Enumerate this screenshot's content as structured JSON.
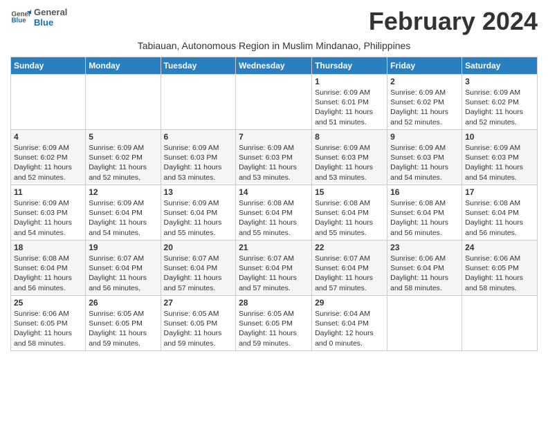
{
  "header": {
    "logo_line1": "General",
    "logo_line2": "Blue",
    "title": "February 2024",
    "subtitle": "Tabiauan, Autonomous Region in Muslim Mindanao, Philippines"
  },
  "days_of_week": [
    "Sunday",
    "Monday",
    "Tuesday",
    "Wednesday",
    "Thursday",
    "Friday",
    "Saturday"
  ],
  "weeks": [
    [
      {
        "day": "",
        "info": ""
      },
      {
        "day": "",
        "info": ""
      },
      {
        "day": "",
        "info": ""
      },
      {
        "day": "",
        "info": ""
      },
      {
        "day": "1",
        "info": "Sunrise: 6:09 AM\nSunset: 6:01 PM\nDaylight: 11 hours\nand 51 minutes."
      },
      {
        "day": "2",
        "info": "Sunrise: 6:09 AM\nSunset: 6:02 PM\nDaylight: 11 hours\nand 52 minutes."
      },
      {
        "day": "3",
        "info": "Sunrise: 6:09 AM\nSunset: 6:02 PM\nDaylight: 11 hours\nand 52 minutes."
      }
    ],
    [
      {
        "day": "4",
        "info": "Sunrise: 6:09 AM\nSunset: 6:02 PM\nDaylight: 11 hours\nand 52 minutes."
      },
      {
        "day": "5",
        "info": "Sunrise: 6:09 AM\nSunset: 6:02 PM\nDaylight: 11 hours\nand 52 minutes."
      },
      {
        "day": "6",
        "info": "Sunrise: 6:09 AM\nSunset: 6:03 PM\nDaylight: 11 hours\nand 53 minutes."
      },
      {
        "day": "7",
        "info": "Sunrise: 6:09 AM\nSunset: 6:03 PM\nDaylight: 11 hours\nand 53 minutes."
      },
      {
        "day": "8",
        "info": "Sunrise: 6:09 AM\nSunset: 6:03 PM\nDaylight: 11 hours\nand 53 minutes."
      },
      {
        "day": "9",
        "info": "Sunrise: 6:09 AM\nSunset: 6:03 PM\nDaylight: 11 hours\nand 54 minutes."
      },
      {
        "day": "10",
        "info": "Sunrise: 6:09 AM\nSunset: 6:03 PM\nDaylight: 11 hours\nand 54 minutes."
      }
    ],
    [
      {
        "day": "11",
        "info": "Sunrise: 6:09 AM\nSunset: 6:03 PM\nDaylight: 11 hours\nand 54 minutes."
      },
      {
        "day": "12",
        "info": "Sunrise: 6:09 AM\nSunset: 6:04 PM\nDaylight: 11 hours\nand 54 minutes."
      },
      {
        "day": "13",
        "info": "Sunrise: 6:09 AM\nSunset: 6:04 PM\nDaylight: 11 hours\nand 55 minutes."
      },
      {
        "day": "14",
        "info": "Sunrise: 6:08 AM\nSunset: 6:04 PM\nDaylight: 11 hours\nand 55 minutes."
      },
      {
        "day": "15",
        "info": "Sunrise: 6:08 AM\nSunset: 6:04 PM\nDaylight: 11 hours\nand 55 minutes."
      },
      {
        "day": "16",
        "info": "Sunrise: 6:08 AM\nSunset: 6:04 PM\nDaylight: 11 hours\nand 56 minutes."
      },
      {
        "day": "17",
        "info": "Sunrise: 6:08 AM\nSunset: 6:04 PM\nDaylight: 11 hours\nand 56 minutes."
      }
    ],
    [
      {
        "day": "18",
        "info": "Sunrise: 6:08 AM\nSunset: 6:04 PM\nDaylight: 11 hours\nand 56 minutes."
      },
      {
        "day": "19",
        "info": "Sunrise: 6:07 AM\nSunset: 6:04 PM\nDaylight: 11 hours\nand 56 minutes."
      },
      {
        "day": "20",
        "info": "Sunrise: 6:07 AM\nSunset: 6:04 PM\nDaylight: 11 hours\nand 57 minutes."
      },
      {
        "day": "21",
        "info": "Sunrise: 6:07 AM\nSunset: 6:04 PM\nDaylight: 11 hours\nand 57 minutes."
      },
      {
        "day": "22",
        "info": "Sunrise: 6:07 AM\nSunset: 6:04 PM\nDaylight: 11 hours\nand 57 minutes."
      },
      {
        "day": "23",
        "info": "Sunrise: 6:06 AM\nSunset: 6:04 PM\nDaylight: 11 hours\nand 58 minutes."
      },
      {
        "day": "24",
        "info": "Sunrise: 6:06 AM\nSunset: 6:05 PM\nDaylight: 11 hours\nand 58 minutes."
      }
    ],
    [
      {
        "day": "25",
        "info": "Sunrise: 6:06 AM\nSunset: 6:05 PM\nDaylight: 11 hours\nand 58 minutes."
      },
      {
        "day": "26",
        "info": "Sunrise: 6:05 AM\nSunset: 6:05 PM\nDaylight: 11 hours\nand 59 minutes."
      },
      {
        "day": "27",
        "info": "Sunrise: 6:05 AM\nSunset: 6:05 PM\nDaylight: 11 hours\nand 59 minutes."
      },
      {
        "day": "28",
        "info": "Sunrise: 6:05 AM\nSunset: 6:05 PM\nDaylight: 11 hours\nand 59 minutes."
      },
      {
        "day": "29",
        "info": "Sunrise: 6:04 AM\nSunset: 6:04 PM\nDaylight: 12 hours\nand 0 minutes."
      },
      {
        "day": "",
        "info": ""
      },
      {
        "day": "",
        "info": ""
      }
    ]
  ]
}
